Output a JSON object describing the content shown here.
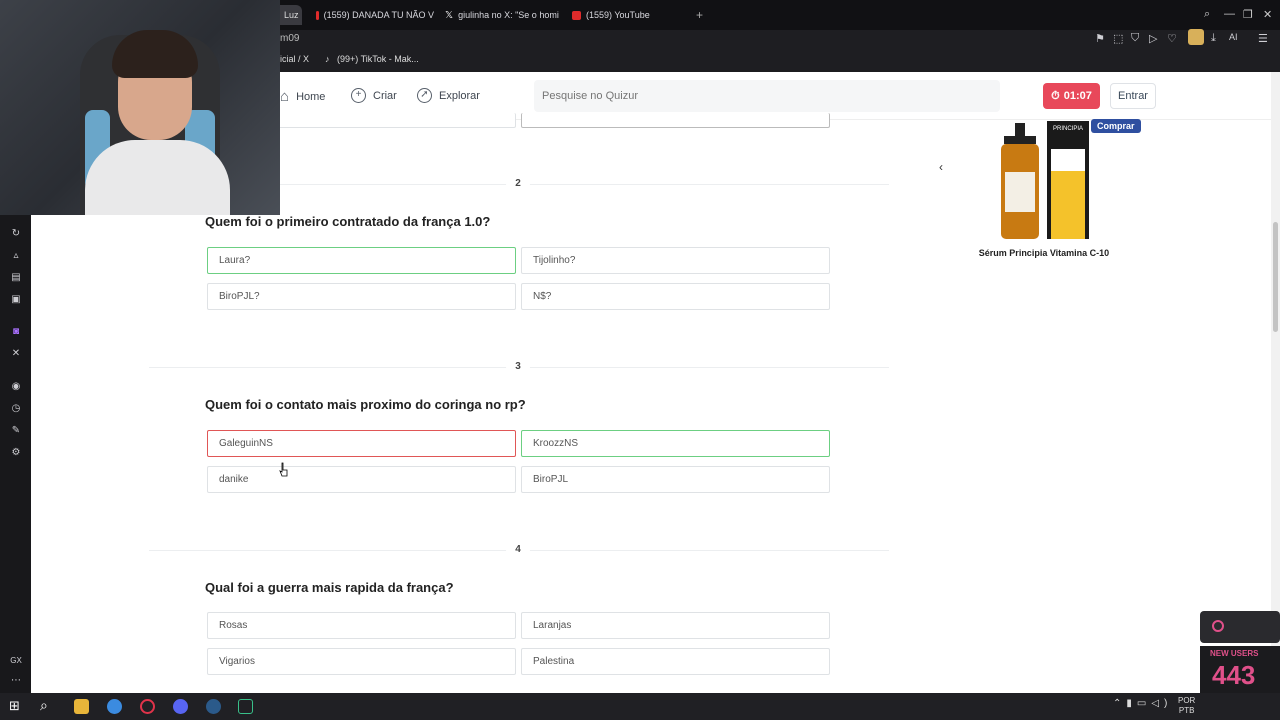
{
  "browser": {
    "tabs": [
      {
        "label": "Luz",
        "icon": "page-icon"
      },
      {
        "label": "(1559) DANADA TU NÃO V",
        "icon": "youtube-icon"
      },
      {
        "label": "giulinha no X: \"Se o homi",
        "icon": "x-icon"
      },
      {
        "label": "(1559) YouTube",
        "icon": "youtube-icon"
      }
    ],
    "new_tab": "+",
    "address_fragment": "m09",
    "bookmarks": [
      {
        "label": "icial / X"
      },
      {
        "label": "(99+) TikTok - Mak..."
      }
    ],
    "toolbar_ai": "AI"
  },
  "nav": {
    "home": "Home",
    "create": "Criar",
    "explore": "Explorar",
    "search_placeholder": "Pesquise no Quizur",
    "timer": "01:07",
    "login": "Entrar"
  },
  "ad": {
    "badge": "Comprar",
    "product": "Sérum Principia Vitamina C-10",
    "brand": "PRINCIPIA"
  },
  "questions": [
    {
      "number": "2",
      "title": "Quem foi o primeiro contratado da frança 1.0?",
      "options": [
        "Laura?",
        "Tijolinho?",
        "BiroPJL?",
        "N$?"
      ]
    },
    {
      "number": "3",
      "title": "Quem foi o contato mais proximo do coringa no rp?",
      "options": [
        "GaleguinNS",
        "KroozzNS",
        "danike",
        "BiroPJL"
      ]
    },
    {
      "number": "4",
      "title": "Qual foi a guerra mais rapida da frança?",
      "options": [
        "Rosas",
        "Laranjas",
        "Vigarios",
        "Palestina"
      ]
    }
  ],
  "overlay": {
    "label": "NEW USERS",
    "count": "443"
  },
  "taskbar": {
    "lang_top": "POR",
    "lang_bottom": "PTB"
  }
}
